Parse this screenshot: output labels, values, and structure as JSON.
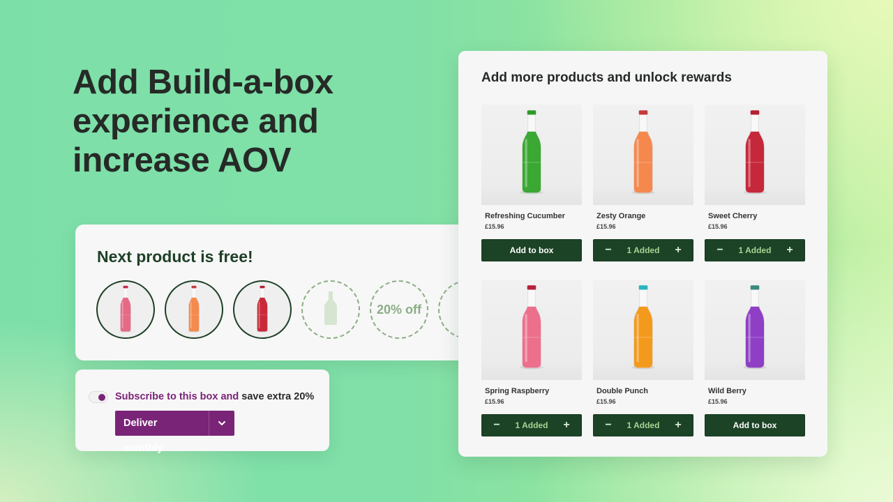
{
  "headline": {
    "lines": [
      "Add Build-a-box",
      "experience and",
      "increase AOV"
    ]
  },
  "free_card": {
    "title": "Next product is free!",
    "slots": [
      {
        "state": "filled",
        "product": "Spring Raspberry",
        "color": "#e56a86",
        "cap": "#c0294a"
      },
      {
        "state": "filled",
        "product": "Zesty Orange",
        "color": "#f58a4e",
        "cap": "#c43a3a"
      },
      {
        "state": "filled",
        "product": "Sweet Cherry",
        "color": "#c92a3a",
        "cap": "#b82030"
      },
      {
        "state": "empty",
        "icon": "bottle-placeholder-icon"
      },
      {
        "state": "empty",
        "label": "20% off"
      },
      {
        "state": "empty"
      }
    ]
  },
  "subscribe": {
    "toggle_on": true,
    "text_accent": "Subscribe to this box and",
    "text_plain": " save extra 20%",
    "frequency": "Deliver monthly",
    "chevron_icon": "chevron-down-icon"
  },
  "panel": {
    "title": "Add more products and unlock rewards",
    "products": [
      {
        "name": "Refreshing Cucumber",
        "price": "£15.96",
        "action": "add",
        "add_label": "Add to box",
        "liquid": "#3aa832",
        "cap": "#2f9a2c"
      },
      {
        "name": "Zesty Orange",
        "price": "£15.96",
        "action": "added",
        "qty_label": "1 Added",
        "liquid": "#f5884d",
        "cap": "#c43a3a"
      },
      {
        "name": "Sweet Cherry",
        "price": "£15.96",
        "action": "added",
        "qty_label": "1 Added",
        "liquid": "#c5283a",
        "cap": "#b52030"
      },
      {
        "name": "Spring Raspberry",
        "price": "£15.96",
        "action": "added",
        "qty_label": "1 Added",
        "liquid": "#ec6f8c",
        "cap": "#b8203e"
      },
      {
        "name": "Double Punch",
        "price": "£15.96",
        "action": "added",
        "qty_label": "1 Added",
        "liquid": "#f39a1c",
        "cap": "#2bb3c0"
      },
      {
        "name": "Wild Berry",
        "price": "£15.96",
        "action": "add",
        "add_label": "Add to box",
        "liquid": "#8e3fc4",
        "cap": "#3a8a7a"
      }
    ],
    "stepper": {
      "minus": "−",
      "plus": "+"
    }
  }
}
